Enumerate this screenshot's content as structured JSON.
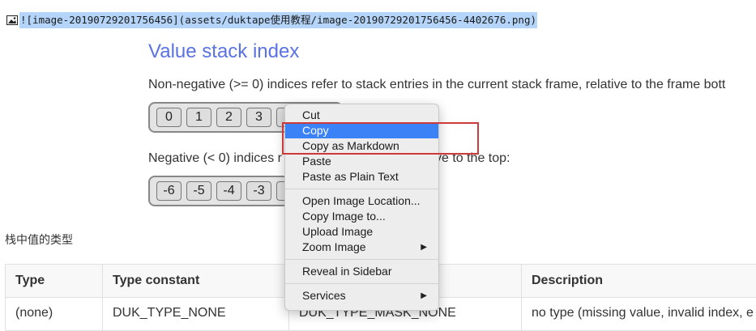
{
  "markdown_line": {
    "text": "![image-20190729201756456](assets/duktape使用教程/image-20190729201756456-4402676.png)",
    "icon": "image-icon"
  },
  "heading": "Value stack index",
  "para1": "Non-negative (>= 0) indices refer to stack entries in the current stack frame, relative to the frame bott",
  "positive_indices": [
    "0",
    "1",
    "2",
    "3"
  ],
  "para2_prefix": "Negative (< 0) indices r",
  "para2_suffix": "ve to the top:",
  "negative_indices": [
    "-6",
    "-5",
    "-4",
    "-3"
  ],
  "section_label": "栈中值的类型",
  "table": {
    "headers": [
      "Type",
      "Type constant",
      "",
      "Description"
    ],
    "rows": [
      [
        "(none)",
        "DUK_TYPE_NONE",
        "DUK_TYPE_MASK_NONE",
        "no type (missing value, invalid index, e"
      ]
    ]
  },
  "context_menu": {
    "items": [
      {
        "label": "Cut"
      },
      {
        "label": "Copy",
        "active": true
      },
      {
        "label": "Copy as Markdown"
      },
      {
        "label": "Paste"
      },
      {
        "label": "Paste as Plain Text"
      },
      {
        "separator": true
      },
      {
        "label": "Open Image Location..."
      },
      {
        "label": "Copy Image to..."
      },
      {
        "label": "Upload Image"
      },
      {
        "label": "Zoom Image",
        "submenu": true
      },
      {
        "separator": true
      },
      {
        "label": "Reveal in Sidebar"
      },
      {
        "separator": true
      },
      {
        "label": "Services",
        "submenu": true
      }
    ]
  },
  "colors": {
    "heading": "#5b72e2",
    "selection": "#b4d5f9",
    "menu_active": "#3b82f7",
    "annotation_box": "#cc3a3a"
  }
}
